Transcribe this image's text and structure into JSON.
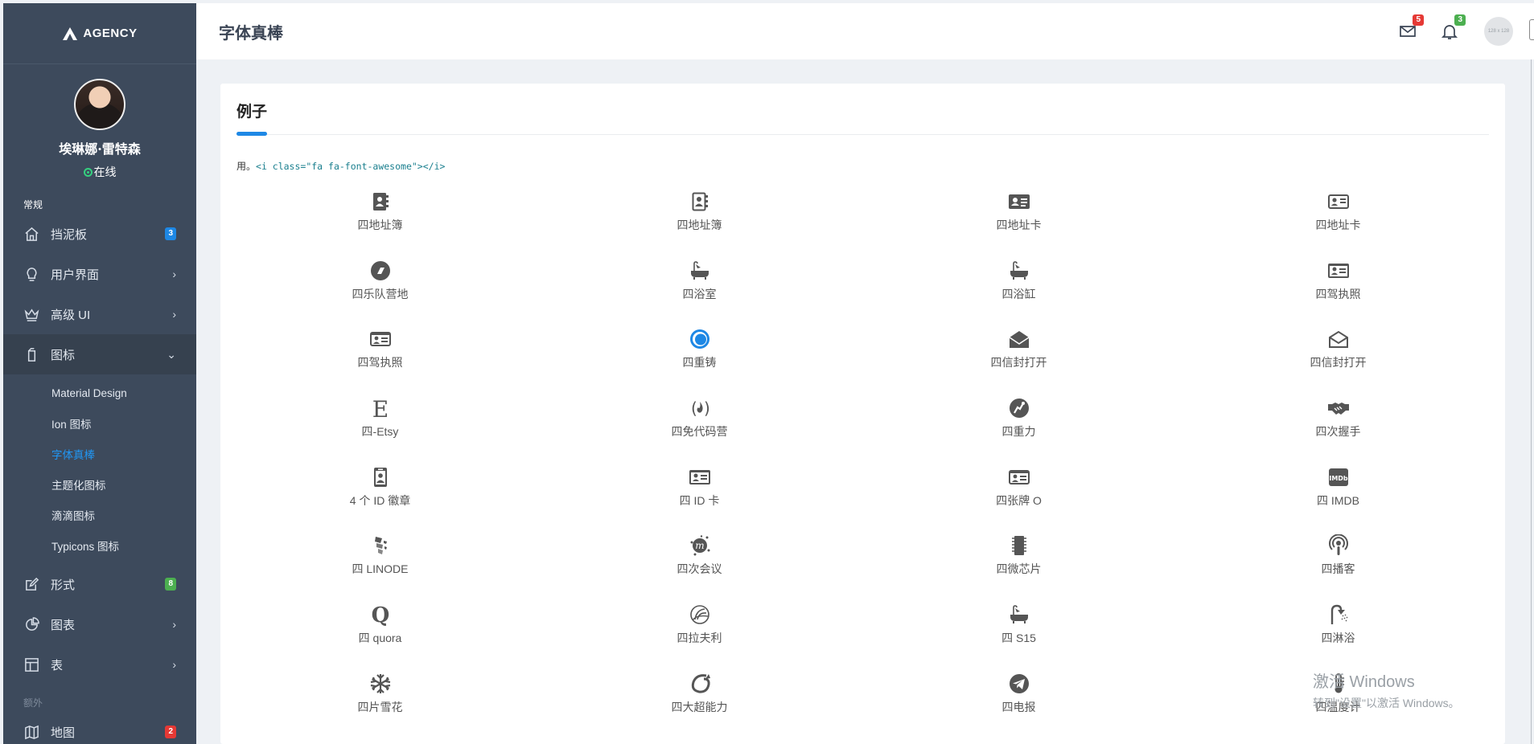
{
  "app": {
    "logo_text": "AGENCY"
  },
  "profile": {
    "name": "埃琳娜·雷特森",
    "status": "在线"
  },
  "sidebar": {
    "section_general": "常规",
    "section_extra": "额外",
    "items": [
      {
        "label": "挡泥板",
        "icon": "home-icon",
        "badge": "3",
        "badge_color": "#1e88e5"
      },
      {
        "label": "用户界面",
        "icon": "lightbulb-icon",
        "chevron": "›"
      },
      {
        "label": "高级 UI",
        "icon": "crown-icon",
        "chevron": "›"
      },
      {
        "label": "图标",
        "icon": "mobile-icon",
        "chevron": "⌄",
        "active": true
      },
      {
        "label": "形式",
        "icon": "edit-icon",
        "badge": "8",
        "badge_color": "#4caf50"
      },
      {
        "label": "图表",
        "icon": "pie-chart-icon",
        "chevron": "›"
      },
      {
        "label": "表",
        "icon": "layout-icon",
        "chevron": "›"
      },
      {
        "label": "地图",
        "icon": "map-icon",
        "badge": "2",
        "badge_color": "#e53935"
      }
    ],
    "subitems": [
      "Material Design",
      "Ion 图标",
      "字体真棒",
      "主题化图标",
      "滴滴图标",
      "Typicons 图标"
    ],
    "current_subitem": "字体真棒"
  },
  "header": {
    "title": "字体真棒",
    "mail_badge": "5",
    "bell_badge": "3",
    "user_avatar_text": "128 x 128"
  },
  "card": {
    "title": "例子",
    "usage_prefix": "用。",
    "usage_code": "<i class=\"fa fa-font-awesome\"></i>",
    "icons": [
      {
        "label": "四地址簿",
        "icon": "address-book-icon"
      },
      {
        "label": "四地址簿",
        "icon": "address-book-o-icon"
      },
      {
        "label": "四地址卡",
        "icon": "address-card-icon"
      },
      {
        "label": "四地址卡",
        "icon": "address-card-o-icon"
      },
      {
        "label": "四乐队营地",
        "icon": "bandcamp-icon"
      },
      {
        "label": "四浴室",
        "icon": "bath-icon"
      },
      {
        "label": "四浴缸",
        "icon": "bathtub-icon"
      },
      {
        "label": "四驾执照",
        "icon": "drivers-license-icon"
      },
      {
        "label": "四驾执照",
        "icon": "drivers-license-o-icon"
      },
      {
        "label": "四重铸",
        "icon": "eercast-icon"
      },
      {
        "label": "四信封打开",
        "icon": "envelope-open-icon"
      },
      {
        "label": "四信封打开",
        "icon": "envelope-open-o-icon"
      },
      {
        "label": "四-Etsy",
        "icon": "etsy-icon"
      },
      {
        "label": "四免代码营",
        "icon": "free-code-camp-icon"
      },
      {
        "label": "四重力",
        "icon": "grav-icon"
      },
      {
        "label": "四次握手",
        "icon": "handshake-icon"
      },
      {
        "label": "4 个 ID 徽章",
        "icon": "id-badge-icon"
      },
      {
        "label": "四 ID 卡",
        "icon": "id-card-icon"
      },
      {
        "label": "四张牌 O",
        "icon": "id-card-o-icon"
      },
      {
        "label": "四 IMDB",
        "icon": "imdb-icon"
      },
      {
        "label": "四 LINODE",
        "icon": "linode-icon"
      },
      {
        "label": "四次会议",
        "icon": "meetup-icon"
      },
      {
        "label": "四微芯片",
        "icon": "microchip-icon"
      },
      {
        "label": "四播客",
        "icon": "podcast-icon"
      },
      {
        "label": "四 quora",
        "icon": "quora-icon"
      },
      {
        "label": "四拉夫利",
        "icon": "ravelry-icon"
      },
      {
        "label": "四 S15",
        "icon": "s15-icon"
      },
      {
        "label": "四淋浴",
        "icon": "shower-icon"
      },
      {
        "label": "四片雪花",
        "icon": "snowflake-icon"
      },
      {
        "label": "四大超能力",
        "icon": "superpowers-icon"
      },
      {
        "label": "四电报",
        "icon": "telegram-icon"
      },
      {
        "label": "四温度计",
        "icon": "thermometer-icon"
      }
    ]
  },
  "watermark": {
    "line1": "激活 Windows",
    "line2": "转到\"设置\"以激活 Windows。"
  },
  "colors": {
    "sidebar_bg": "#3d4a5c",
    "accent": "#1e88e5",
    "icon_gray": "#555555"
  }
}
